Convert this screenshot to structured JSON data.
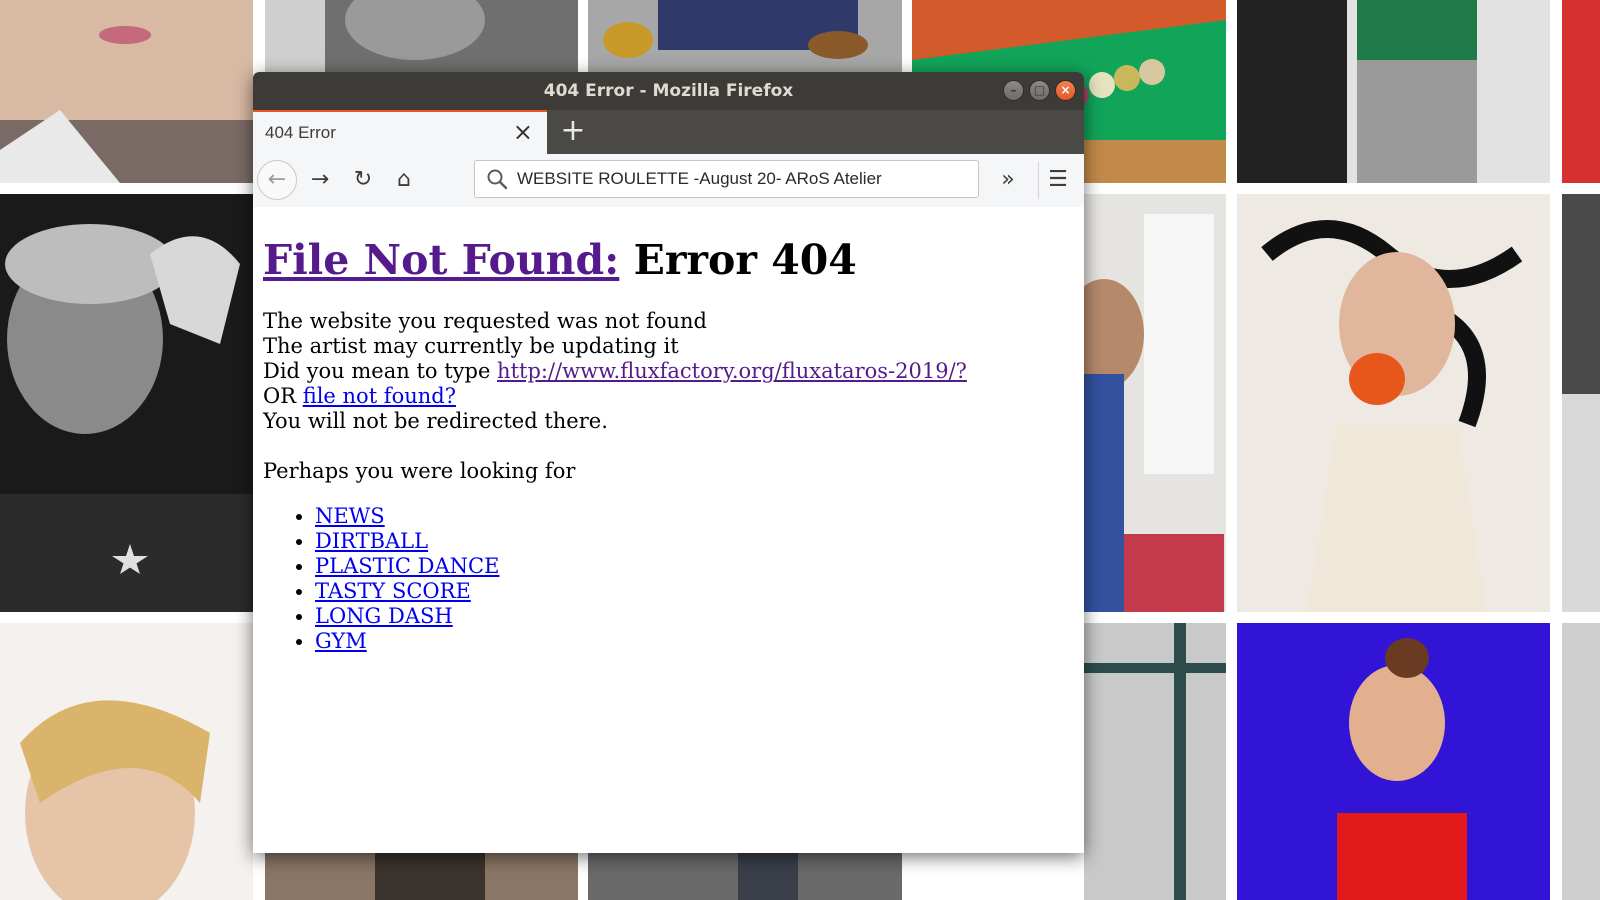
{
  "window": {
    "title": "404 Error - Mozilla Firefox",
    "buttons": {
      "minimize": "–",
      "maximize": "□",
      "close": "×"
    }
  },
  "tabs": [
    {
      "label": "404 Error",
      "close": "×"
    }
  ],
  "toolbar": {
    "new_tab": "+",
    "back": "←",
    "forward": "→",
    "reload": "↻",
    "home": "⌂",
    "overflow": "»",
    "menu": "☰"
  },
  "address_bar": {
    "value": "WEBSITE ROULETTE -August 20- ARoS Atelier"
  },
  "page": {
    "heading_link": "File Not Found:",
    "heading_rest": " Error 404",
    "lines": [
      "The website you requested was not found",
      "The artist may currently be updating it"
    ],
    "did_you_mean_prefix": "Did you mean to type ",
    "did_you_mean_link": "http://www.fluxfactory.org/fluxataros-2019/?",
    "or_prefix": "OR ",
    "or_link": "file not found?",
    "redirect_note": "You will not be redirected there.",
    "perhaps": "Perhaps you were looking for",
    "links": [
      "NEWS",
      "DIRTBALL",
      "PLASTIC DANCE",
      "TASTY SCORE",
      "LONG DASH",
      "GYM"
    ]
  },
  "colors": {
    "link": "#0000ee",
    "visited_link": "#551a8b",
    "titlebar": "#3c3b37",
    "tab_accent": "#e95420"
  }
}
